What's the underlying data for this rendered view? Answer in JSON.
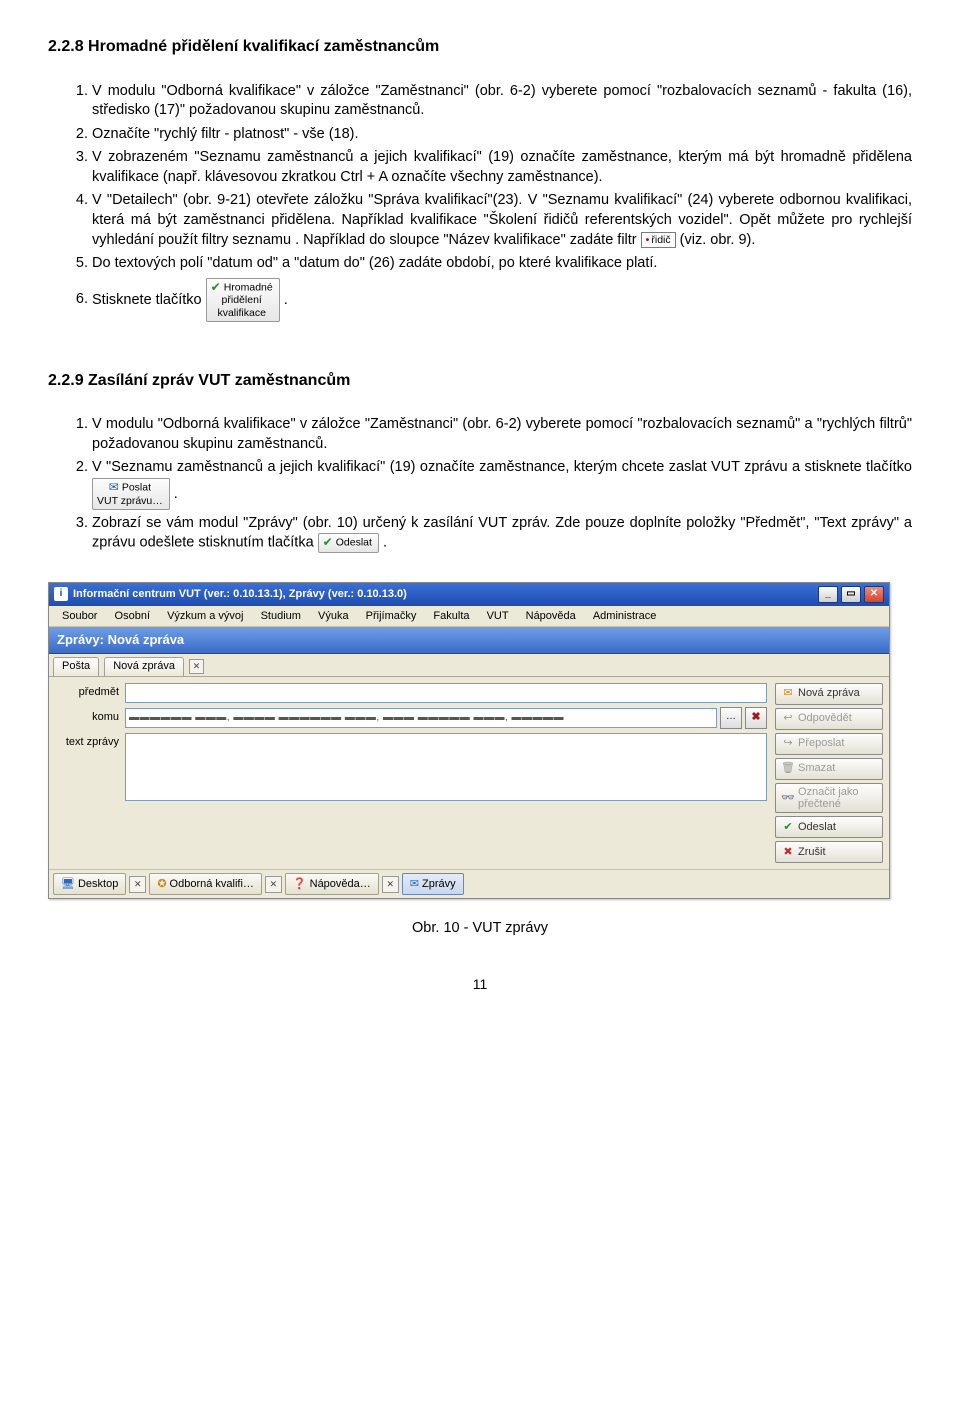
{
  "heading_228": "2.2.8 Hromadné přidělení kvalifikací zaměstnancům",
  "list_228": {
    "i1": "V modulu \"Odborná kvalifikace\" v záložce \"Zaměstnanci\" (obr. 6-2) vyberete pomocí \"rozbalovacích seznamů - fakulta (16), středisko (17)\" požadovanou skupinu zaměstnanců.",
    "i2": "Označíte \"rychlý filtr - platnost\" - vše (18).",
    "i3": "V zobrazeném \"Seznamu zaměstnanců a jejich kvalifikací\" (19) označíte zaměstnance, kterým má být hromadně přidělena kvalifikace (např. klávesovou zkratkou Ctrl + A označíte všechny zaměstnance).",
    "i4_a": "V \"Detailech\" (obr. 9-21) otevřete záložku \"Správa kvalifikací\"(23). V \"Seznamu kvalifikací\" (24) vyberete odbornou kvalifikaci, která má být zaměstnanci přidělena. Například kvalifikace \"Školení řidičů referentských vozidel\". Opět můžete pro rychlejší vyhledání použít filtry seznamu . Například do sloupce \"Název kvalifikace\" zadáte filtr ",
    "i4_filter": "řidič",
    "i4_b": " (viz. obr. 9).",
    "i5": "Do textových polí \"datum od\" a \"datum do\" (26) zadáte období, po které kvalifikace platí.",
    "i6_a": "Stisknete tlačítko ",
    "i6_btn_l1": "Hromadné",
    "i6_btn_l2": "přidělení",
    "i6_btn_l3": "kvalifikace",
    "i6_b": " ."
  },
  "heading_229": "2.2.9 Zasílání zpráv VUT zaměstnancům",
  "list_229": {
    "i1": "V modulu \"Odborná kvalifikace\" v záložce \"Zaměstnanci\" (obr. 6-2) vyberete pomocí \"rozbalovacích seznamů\" a \"rychlých filtrů\" požadovanou skupinu zaměstnanců.",
    "i2_a": "V \"Seznamu zaměstnanců a jejich kvalifikací\" (19) označíte zaměstnance, kterým chcete zaslat VUT zprávu a stisknete tlačítko ",
    "i2_btn_l1": "Poslat",
    "i2_btn_l2": "VUT zprávu…",
    "i2_b": " .",
    "i3_a": "Zobrazí se vám modul \"Zprávy\" (obr. 10) určený k zasílání VUT zpráv. Zde pouze doplníte položky \"Předmět\", \"Text zprávy\" a zprávu odešlete stisknutím tlačítka ",
    "i3_btn": "Odeslat",
    "i3_b": " ."
  },
  "shot": {
    "title": "Informační centrum VUT (ver.: 0.10.13.1), Zprávy (ver.: 0.10.13.0)",
    "menu": [
      "Soubor",
      "Osobní",
      "Výzkum a vývoj",
      "Studium",
      "Výuka",
      "Přijímačky",
      "Fakulta",
      "VUT",
      "Nápověda",
      "Administrace"
    ],
    "blueband": "Zprávy: Nová zpráva",
    "tab_posta": "Pošta",
    "tab_nova": "Nová zpráva",
    "label_predmet": "předmět",
    "label_komu": "komu",
    "label_text": "text zprávy",
    "field_komu": "▬▬▬▬▬▬ ▬▬▬, ▬▬▬▬ ▬▬▬▬▬▬ ▬▬▬, ▬▬▬ ▬▬▬▬▬ ▬▬▬, ▬▬▬▬▬",
    "side": {
      "nova": "Nová zpráva",
      "odpovedet": "Odpovědět",
      "preposlat": "Přeposlat",
      "smazat": "Smazat",
      "oznacit_l1": "Označit jako",
      "oznacit_l2": "přečtené",
      "odeslat": "Odeslat",
      "zrusit": "Zrušit"
    },
    "taskbar": {
      "desktop": "Desktop",
      "odborna": "Odborná kvalifi…",
      "napoveda": "Nápověda…",
      "zpravy": "Zprávy"
    }
  },
  "figure_caption": "Obr. 10 - VUT zprávy",
  "page_number": "11"
}
